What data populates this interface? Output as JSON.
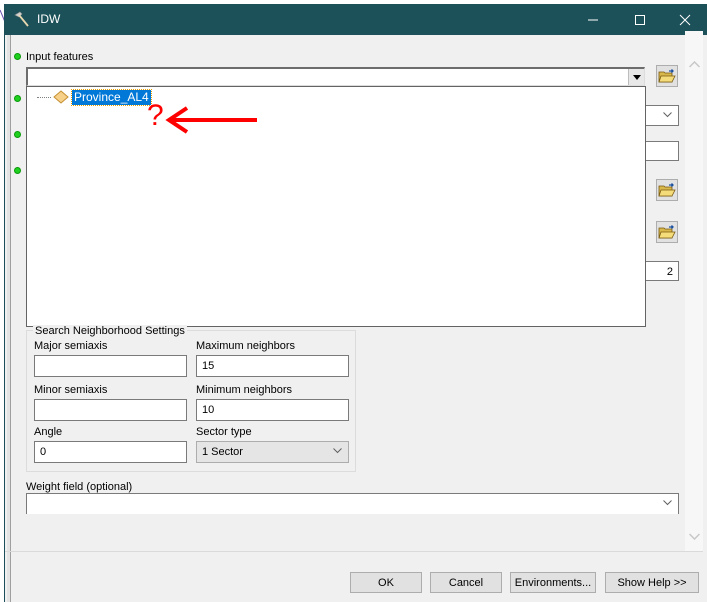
{
  "window": {
    "title": "IDW",
    "controls": {
      "minimize": "minimize",
      "maximize": "maximize",
      "close": "close"
    }
  },
  "form": {
    "input_features": {
      "label": "Input features",
      "value": "",
      "dropdown_items": [
        {
          "label": "Province_AL4",
          "icon": "point-layer-diamond-icon",
          "selected": true
        }
      ]
    },
    "hidden_param_values": {
      "power": "2"
    },
    "search_neighborhood": {
      "legend": "Search Neighborhood Settings",
      "major_semiaxis": {
        "label": "Major semiaxis",
        "value": ""
      },
      "maximum_neighbors": {
        "label": "Maximum neighbors",
        "value": "15"
      },
      "minor_semiaxis": {
        "label": "Minor semiaxis",
        "value": ""
      },
      "minimum_neighbors": {
        "label": "Minimum neighbors",
        "value": "10"
      },
      "angle": {
        "label": "Angle",
        "value": "0"
      },
      "sector_type": {
        "label": "Sector type",
        "value": "1 Sector"
      }
    },
    "weight_field": {
      "label": "Weight field (optional)",
      "value": ""
    }
  },
  "annotation": {
    "text": "?",
    "color": "#ff0000"
  },
  "buttons": {
    "ok": "OK",
    "cancel": "Cancel",
    "environments": "Environments...",
    "show_help": "Show Help >>"
  },
  "colors": {
    "titlebar": "#1c5159",
    "required_bullet": "#1fd01f",
    "selection": "#0078d7"
  }
}
